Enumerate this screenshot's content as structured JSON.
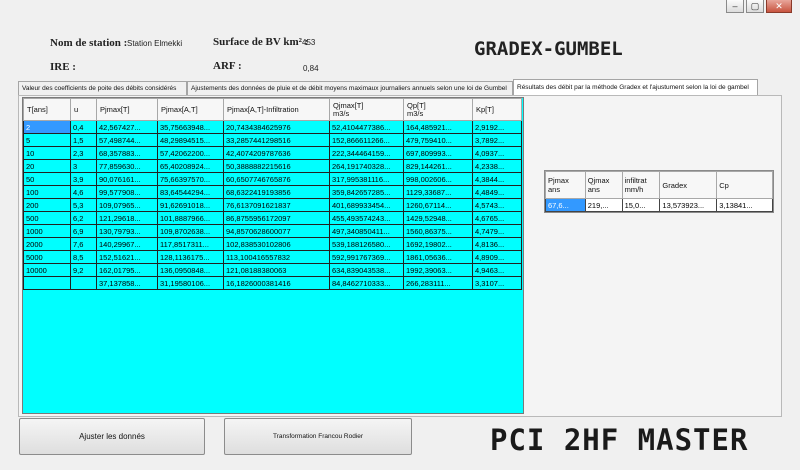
{
  "window": {
    "min_glyph": "–",
    "max_glyph": "▢",
    "close_glyph": "✕"
  },
  "header": {
    "station_label": "Nom de station :",
    "station_value": "Station Elmekki",
    "surface_label": "Surface de BV km² :",
    "surface_value": "453",
    "ire_label": "IRE :",
    "arf_label": "ARF :",
    "arf_value": "0,84",
    "app_title": "GRADEX-GUMBEL"
  },
  "tabs": [
    {
      "label": "Valeur des coefficients de poite des débits considérés"
    },
    {
      "label": "Ajustements des données de pluie et de débit moyens maximaux journaliers annuels selon une loi de Gumbel"
    },
    {
      "label": "Résultats des débit par la méthode Gradex et l'ajustument selon la loi de gambel"
    }
  ],
  "main_table": {
    "columns": [
      "T[ans]",
      "u",
      "Pjmax[T]",
      "Pjmax[A,T]",
      "Pjmax[A,T]-Infiltration",
      "Qjmax[T]\nm3/s",
      "Qp[T]\nm3/s",
      "Kp[T]"
    ],
    "rows": [
      [
        "2",
        "0,4",
        "42,567427...",
        "35,75663948...",
        "20,7434384625976",
        "52,4104477386...",
        "164,485921...",
        "2,9192..."
      ],
      [
        "5",
        "1,5",
        "57,498744...",
        "48,29894515...",
        "33,2857441298516",
        "152,866611266...",
        "479,759410...",
        "3,7892..."
      ],
      [
        "10",
        "2,3",
        "68,357883...",
        "57,42062200...",
        "42,4074209787636",
        "222,344464159...",
        "697,809993...",
        "4,0937..."
      ],
      [
        "20",
        "3",
        "77,859630...",
        "65,40208924...",
        "50,3888882215616",
        "264,191740328...",
        "829,144261...",
        "4,2338..."
      ],
      [
        "50",
        "3,9",
        "90,076161...",
        "75,66397570...",
        "60,6507746765876",
        "317,995381116...",
        "998,002606...",
        "4,3844..."
      ],
      [
        "100",
        "4,6",
        "99,577908...",
        "83,64544294...",
        "68,6322419193856",
        "359,842657285...",
        "1129,33687...",
        "4,4849..."
      ],
      [
        "200",
        "5,3",
        "109,07965...",
        "91,62691018...",
        "76,6137091621837",
        "401,689933454...",
        "1260,67114...",
        "4,5743..."
      ],
      [
        "500",
        "6,2",
        "121,29618...",
        "101,8887966...",
        "86,8755956172097",
        "455,493574243...",
        "1429,52948...",
        "4,6765..."
      ],
      [
        "1000",
        "6,9",
        "130,79793...",
        "109,8702638...",
        "94,8570628600077",
        "497,340850411...",
        "1560,86375...",
        "4,7479..."
      ],
      [
        "2000",
        "7,6",
        "140,29967...",
        "117,8517311...",
        "102,838530102806",
        "539,188126580...",
        "1692,19802...",
        "4,8136..."
      ],
      [
        "5000",
        "8,5",
        "152,51621...",
        "128,1136175...",
        "113,100416557832",
        "592,991767369...",
        "1861,05636...",
        "4,8909..."
      ],
      [
        "10000",
        "9,2",
        "162,01795...",
        "136,0950848...",
        "121,08188380063",
        "634,839043538...",
        "1992,39063...",
        "4,9463..."
      ],
      [
        "",
        "",
        "37,137858...",
        "31,19580106...",
        "16,1826000381416",
        "84,8462710333...",
        "266,283111...",
        "3,3107..."
      ]
    ]
  },
  "side_table": {
    "columns": [
      "Pjmax\nans",
      "Qjmax\nans",
      "infiltrat\nmm/h",
      "Gradex",
      "Cp"
    ],
    "rows": [
      [
        "67,6...",
        "219,...",
        "15,0...",
        "13,573923...",
        "3,13841..."
      ]
    ]
  },
  "buttons": {
    "adjust": "Ajuster les donnés",
    "transform": "Transformation Francou Rodier"
  },
  "footer_title": "PCI 2HF MASTER",
  "colors": {
    "grid_bg": "#00ffff",
    "selection": "#3399ff"
  }
}
